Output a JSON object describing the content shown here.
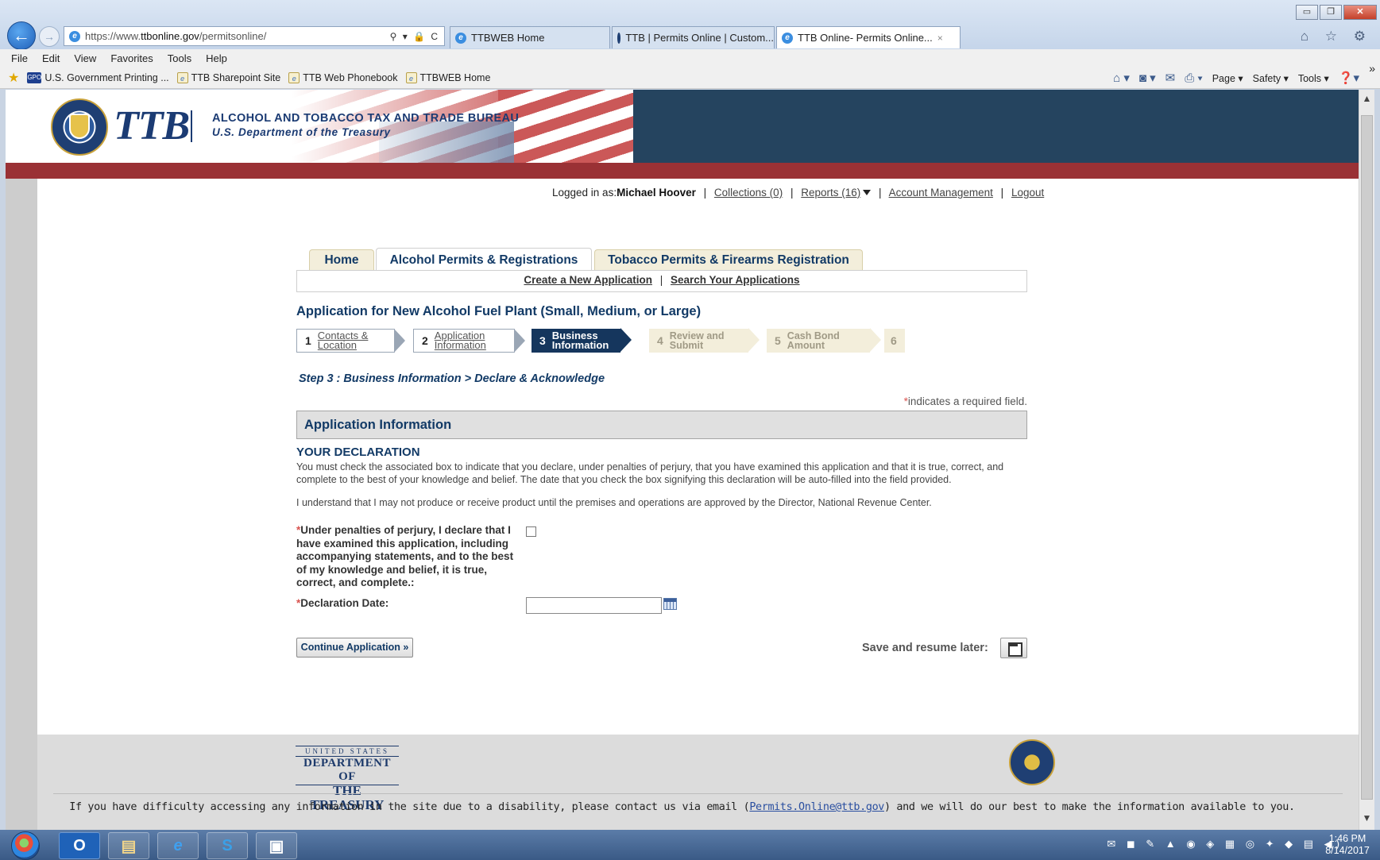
{
  "browser": {
    "url_scheme": "https://www.",
    "url_domain": "ttbonline.gov",
    "url_path": "/permitsonline/",
    "addr_icons": "⚲ ▾ 🔒 C",
    "tabs": [
      {
        "label": "TTBWEB Home"
      },
      {
        "label": "TTB | Permits Online | Custom..."
      },
      {
        "label": "TTB Online- Permits Online..."
      }
    ],
    "tab_close": "×",
    "menu": [
      "File",
      "Edit",
      "View",
      "Favorites",
      "Tools",
      "Help"
    ],
    "favorites": [
      "U.S. Government Printing ...",
      "TTB Sharepoint Site",
      "TTB Web Phonebook",
      "TTBWEB Home"
    ],
    "gpo_badge": "GPO",
    "commands": [
      "Page ▾",
      "Safety ▾",
      "Tools ▾"
    ],
    "chevrons": "»",
    "win_min": "▭",
    "win_max": "❐",
    "win_close": "✕",
    "home_star_gear": "⌂ ☆ ⚙"
  },
  "header": {
    "brand": "TTB",
    "bureau_line1": "ALCOHOL AND TOBACCO TAX AND TRADE BUREAU",
    "bureau_line2": "U.S. Department of the Treasury"
  },
  "user_bar": {
    "logged_in_prefix": "Logged in as:",
    "user_name": "Michael Hoover",
    "collections": "Collections (0)",
    "reports": "Reports (16)",
    "account": "Account Management",
    "logout": "Logout",
    "sep": "|"
  },
  "nav": {
    "tabs": [
      "Home",
      "Alcohol Permits & Registrations",
      "Tobacco Permits & Firearms Registration"
    ],
    "sub_create": "Create a New Application",
    "sub_search": "Search Your Applications",
    "sep": "|"
  },
  "app_title": "Application for New Alcohol Fuel Plant (Small, Medium, or Large)",
  "steps": [
    {
      "num": "1",
      "label": "Contacts & Location"
    },
    {
      "num": "2",
      "label": "Application Information"
    },
    {
      "num": "3",
      "label": "Business Information"
    },
    {
      "num": "4",
      "label": "Review and Submit"
    },
    {
      "num": "5",
      "label": "Cash Bond Amount"
    },
    {
      "num": "6",
      "label": ""
    }
  ],
  "step_heading": "Step 3 : Business Information > Declare & Acknowledge",
  "required_note": "indicates a required field.",
  "required_star": "*",
  "section_title": "Application Information",
  "declaration": {
    "title": "YOUR DECLARATION",
    "text": "You must check the associated box to indicate that you declare, under penalties of perjury, that you have examined this application and that it is true, correct, and complete to the best of your knowledge and belief. The date that you check the box signifying this declaration will be auto-filled into the field provided.",
    "text2": "I understand that I may not produce or receive product until the premises and operations are approved by the Director, National Revenue Center.",
    "checkbox_label": "Under penalties of perjury, I declare that I have examined this application, including accompanying statements, and to the best of my knowledge and belief, it is true, correct, and complete.:",
    "date_label": "Declaration Date:",
    "date_value": ""
  },
  "actions": {
    "continue": "Continue Application »",
    "save_label": "Save and resume later:"
  },
  "footer": {
    "treasury_line1": "UNITED STATES",
    "treasury_line2": "DEPARTMENT OF",
    "treasury_line3": "THE TREASURY",
    "text_before": "If you have difficulty accessing any information in the site due to a disability, please contact us via email (",
    "email": "Permits.Online@ttb.gov",
    "text_after": ") and we will do our best to make the information available to you."
  },
  "taskbar": {
    "clock_time": "1:46 PM",
    "clock_date": "8/14/2017",
    "apps": [
      "O",
      "▤",
      "e",
      "S",
      "▣"
    ],
    "tray": "✉ ◼ ✎ ▲ ◉ ◈ ▦ ◎ ✦ ◆ ▤ ◀)"
  },
  "colors": {
    "navy": "#123a66",
    "header_dark": "#25445f",
    "red_bar": "#9a3135",
    "tab_beige": "#f3eedb",
    "current_step": "#15365d"
  }
}
